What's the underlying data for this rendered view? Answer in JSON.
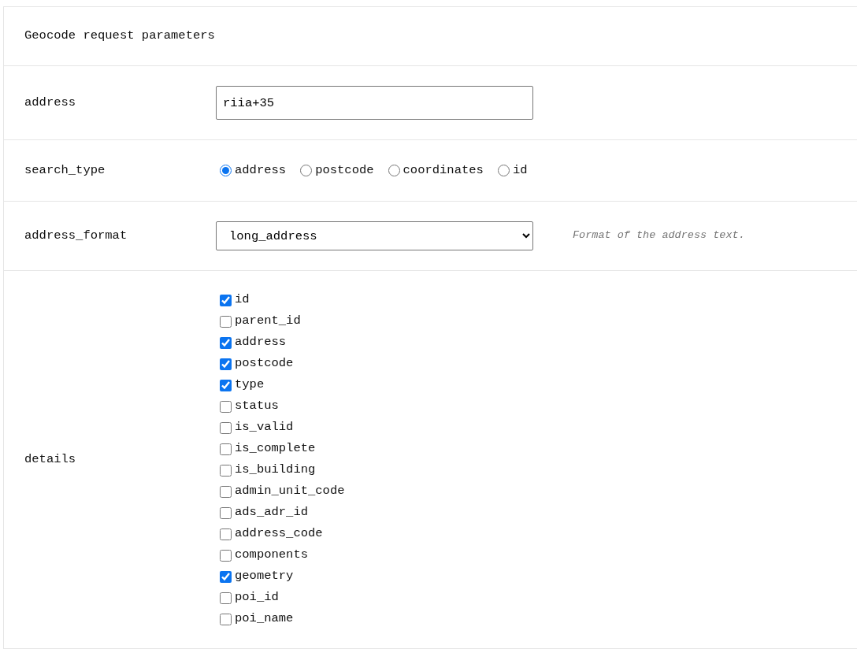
{
  "title": "Geocode request parameters",
  "address": {
    "label": "address",
    "value": "riia+35"
  },
  "search_type": {
    "label": "search_type",
    "options": [
      {
        "label": "address",
        "selected": true
      },
      {
        "label": "postcode",
        "selected": false
      },
      {
        "label": "coordinates",
        "selected": false
      },
      {
        "label": "id",
        "selected": false
      }
    ]
  },
  "address_format": {
    "label": "address_format",
    "value": "long_address",
    "hint": "Format of the address text."
  },
  "details": {
    "label": "details",
    "options": [
      {
        "label": "id",
        "checked": true
      },
      {
        "label": "parent_id",
        "checked": false
      },
      {
        "label": "address",
        "checked": true
      },
      {
        "label": "postcode",
        "checked": true
      },
      {
        "label": "type",
        "checked": true
      },
      {
        "label": "status",
        "checked": false
      },
      {
        "label": "is_valid",
        "checked": false
      },
      {
        "label": "is_complete",
        "checked": false
      },
      {
        "label": "is_building",
        "checked": false
      },
      {
        "label": "admin_unit_code",
        "checked": false
      },
      {
        "label": "ads_adr_id",
        "checked": false
      },
      {
        "label": "address_code",
        "checked": false
      },
      {
        "label": "components",
        "checked": false
      },
      {
        "label": "geometry",
        "checked": true
      },
      {
        "label": "poi_id",
        "checked": false
      },
      {
        "label": "poi_name",
        "checked": false
      }
    ]
  }
}
